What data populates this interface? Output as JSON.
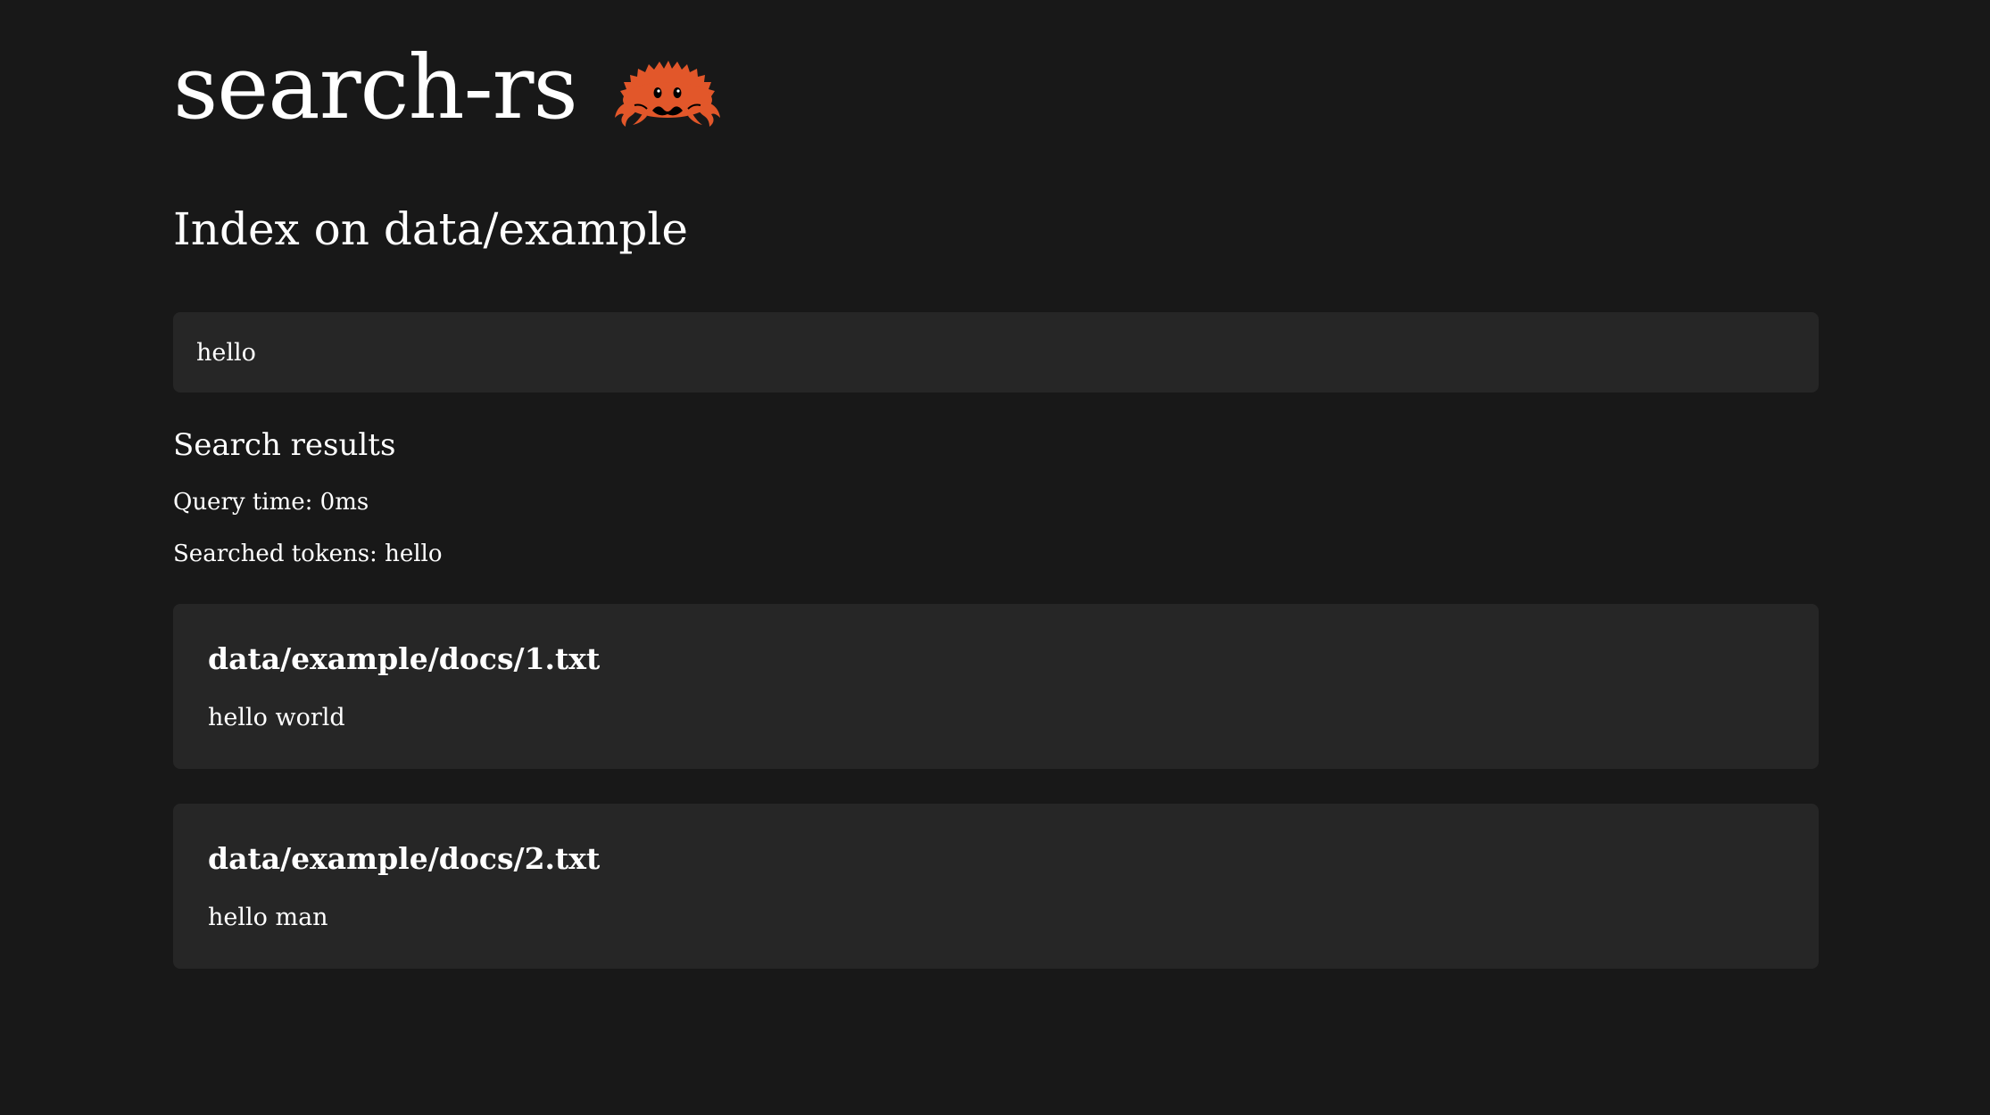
{
  "header": {
    "app_title": "search-rs",
    "logo_icon": "ferris-crab-icon",
    "logo_color": "#e2572a"
  },
  "index": {
    "heading": "Index on data/example"
  },
  "search": {
    "value": "hello"
  },
  "results": {
    "heading": "Search results",
    "query_time": "Query time: 0ms",
    "searched_tokens": "Searched tokens: hello",
    "items": [
      {
        "path": "data/example/docs/1.txt",
        "snippet": "hello world"
      },
      {
        "path": "data/example/docs/2.txt",
        "snippet": "hello man"
      }
    ]
  },
  "colors": {
    "background": "#181818",
    "card": "#262626",
    "text": "#ffffff"
  }
}
